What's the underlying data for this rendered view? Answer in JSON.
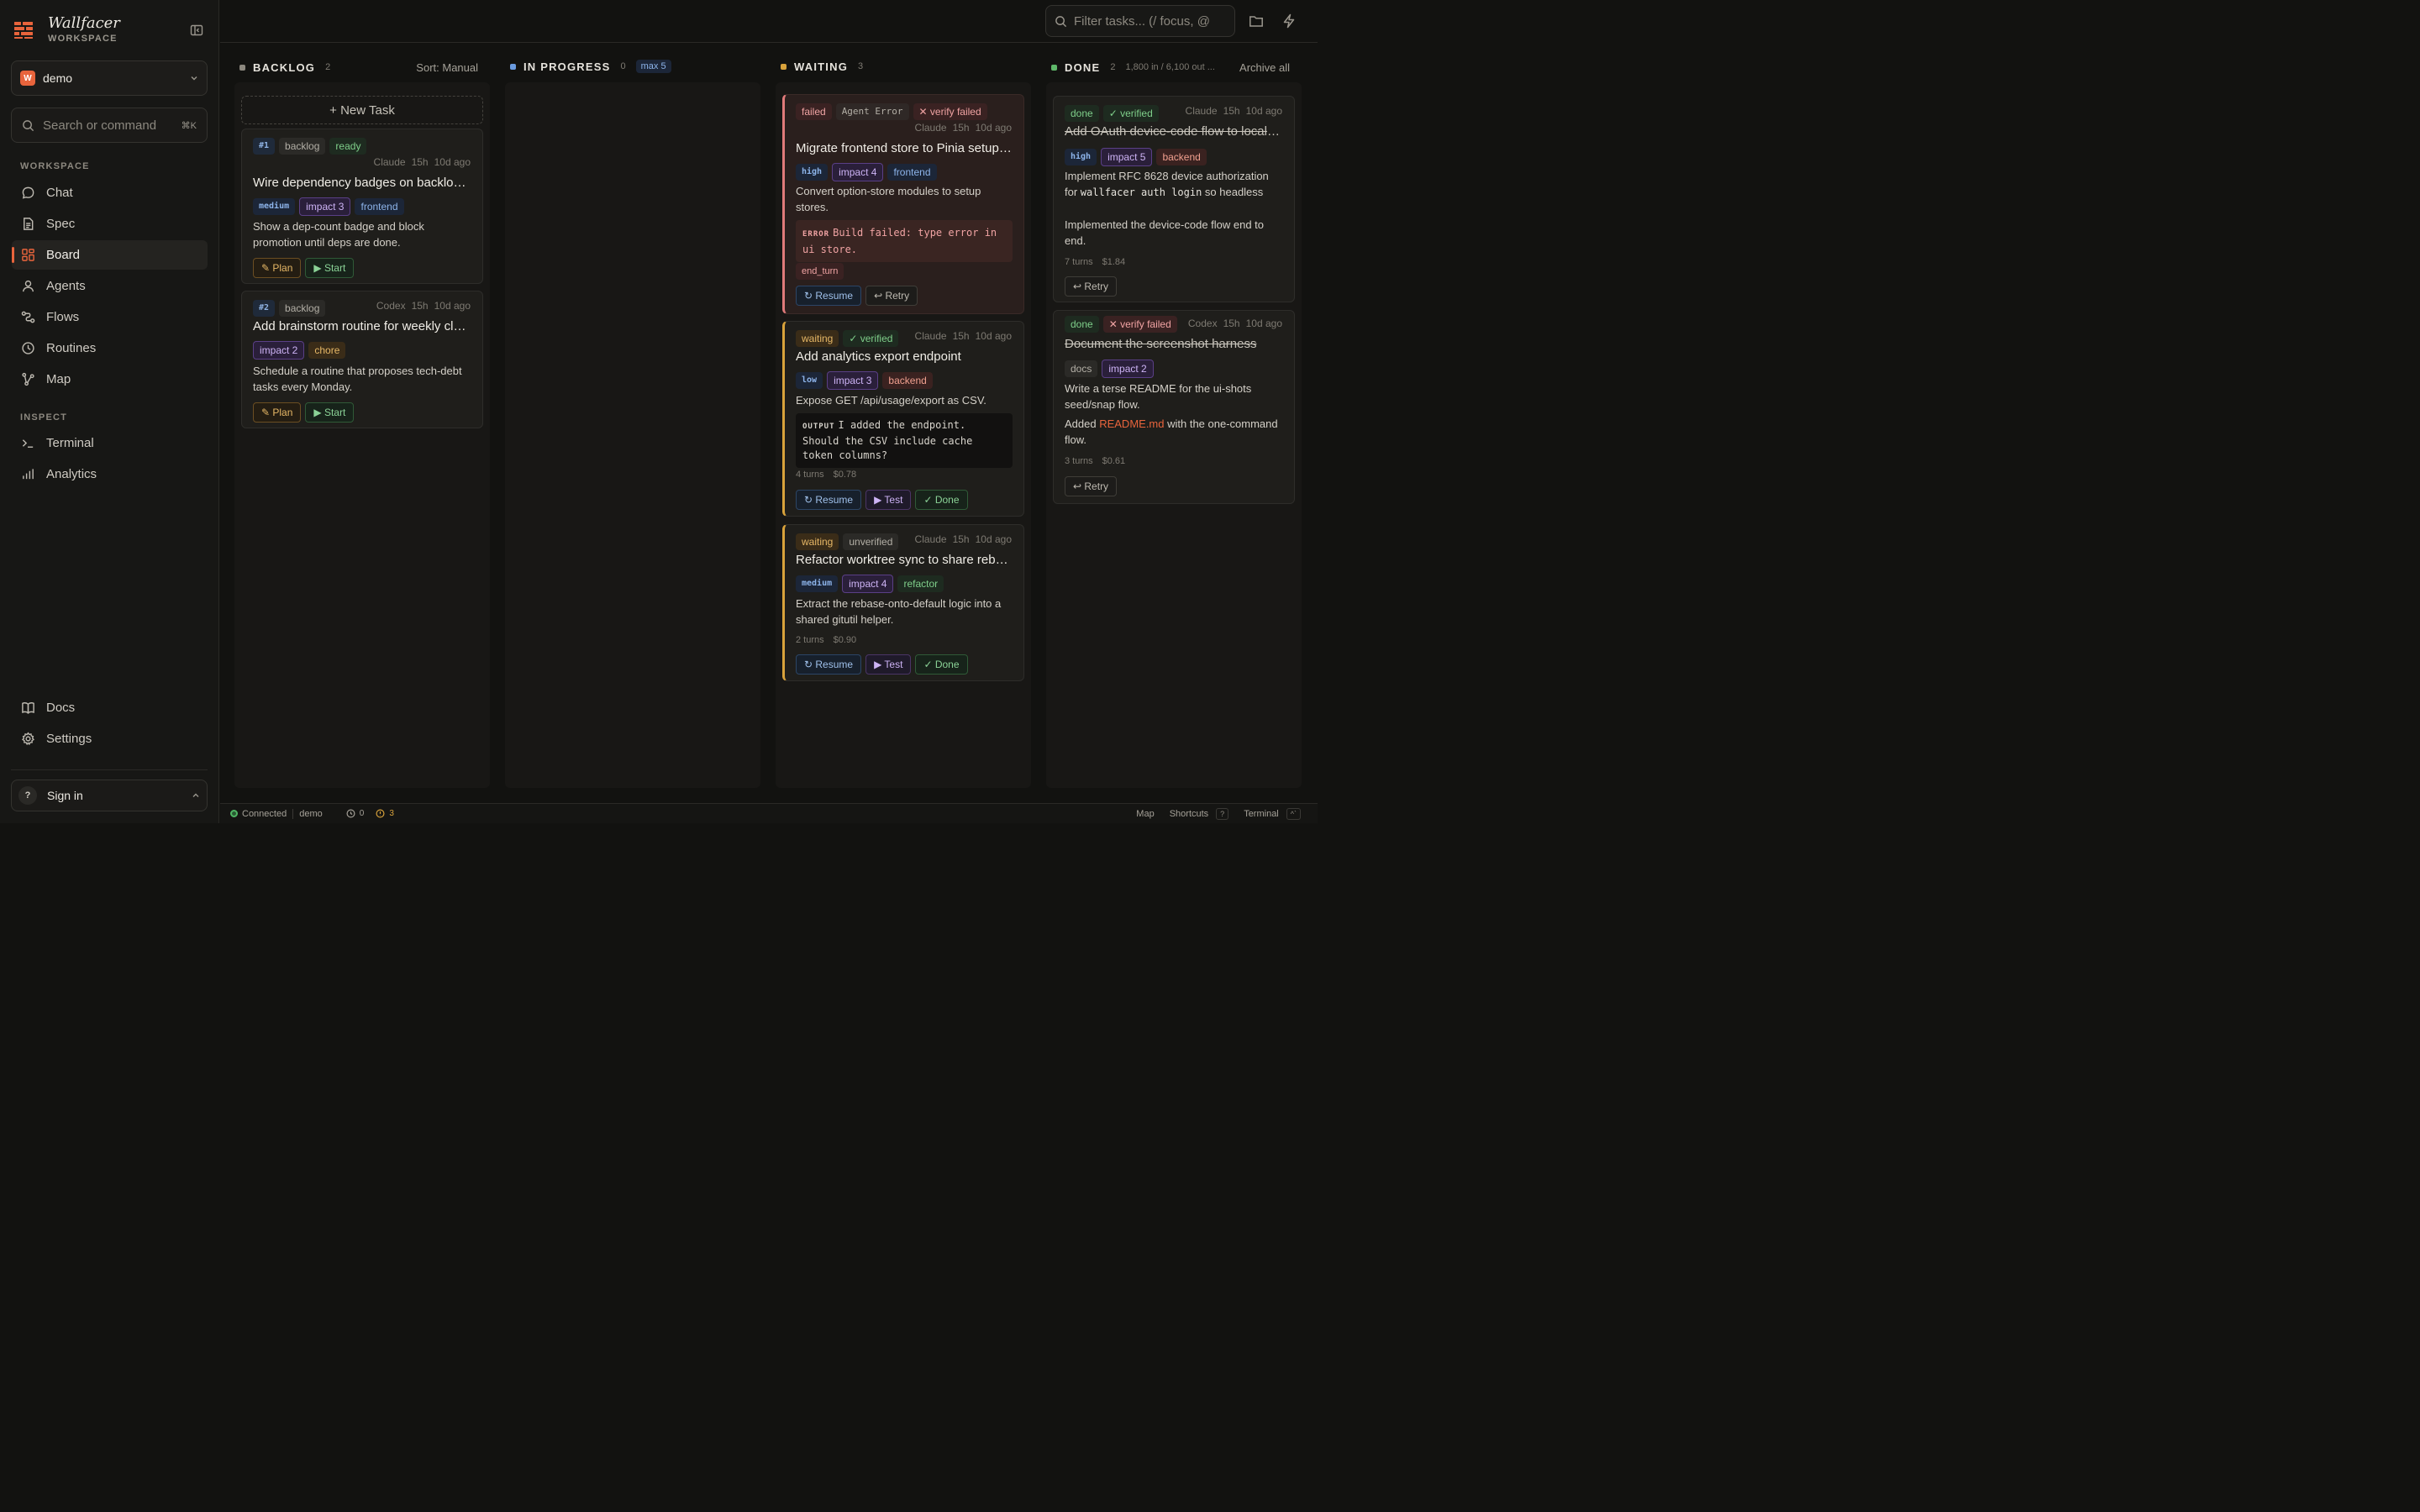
{
  "brand": {
    "title": "Wallfacer",
    "subtitle": "WORKSPACE",
    "logo_icon": "brick-wall-icon"
  },
  "workspace": {
    "badge": "W",
    "name": "demo"
  },
  "search": {
    "placeholder": "Search or command",
    "shortcut": "⌘K"
  },
  "nav": {
    "workspace_label": "WORKSPACE",
    "inspect_label": "INSPECT",
    "items": [
      {
        "label": "Chat",
        "icon": "chat-bubble-icon"
      },
      {
        "label": "Spec",
        "icon": "document-icon"
      },
      {
        "label": "Board",
        "icon": "grid-icon",
        "active": true
      },
      {
        "label": "Agents",
        "icon": "person-icon"
      },
      {
        "label": "Flows",
        "icon": "flow-icon"
      },
      {
        "label": "Routines",
        "icon": "clock-icon"
      },
      {
        "label": "Map",
        "icon": "branch-icon"
      },
      {
        "label": "Terminal",
        "icon": "terminal-icon"
      },
      {
        "label": "Analytics",
        "icon": "bar-chart-icon"
      },
      {
        "label": "Docs",
        "icon": "book-icon"
      },
      {
        "label": "Settings",
        "icon": "gear-icon"
      }
    ]
  },
  "signin": {
    "avatar": "?",
    "label": "Sign in"
  },
  "topbar": {
    "filter_placeholder": "Filter tasks... (/ focus, @"
  },
  "columns": {
    "backlog": {
      "title": "BACKLOG",
      "count": "2",
      "right": "Sort: Manual",
      "color": "#8c887f"
    },
    "in_progress": {
      "title": "IN PROGRESS",
      "count": "0",
      "badge": "max 5",
      "color": "#6a9be0"
    },
    "waiting": {
      "title": "WAITING",
      "count": "3",
      "color": "#d8a23b"
    },
    "done": {
      "title": "DONE",
      "count": "2",
      "usage": "1,800 in / 6,100 out ...",
      "right": "Archive all",
      "color": "#5fb86a"
    }
  },
  "new_task_label": "+ New Task",
  "backlog_cards": [
    {
      "id": "#1",
      "status": "backlog",
      "state": "ready",
      "agent": "Claude",
      "time": "15h",
      "age": "10d ago",
      "title": "Wire dependency badges on backlog cards",
      "priority": "medium",
      "impact": "impact 3",
      "area": "frontend",
      "desc": "Show a dep-count badge and block promotion until deps are done.",
      "btn_plan": "✎ Plan",
      "btn_start": "▶ Start"
    },
    {
      "id": "#2",
      "status": "backlog",
      "agent": "Codex",
      "time": "15h",
      "age": "10d ago",
      "title": "Add brainstorm routine for weekly cleanup",
      "impact": "impact 2",
      "area": "chore",
      "desc": "Schedule a routine that proposes tech-debt tasks every Monday.",
      "btn_plan": "✎ Plan",
      "btn_start": "▶ Start"
    }
  ],
  "waiting_cards": [
    {
      "status": "failed",
      "error_tag": "Agent Error",
      "verify": "✕ verify failed",
      "agent": "Claude",
      "time": "15h",
      "age": "10d ago",
      "title": "Migrate frontend store to Pinia setup stores",
      "priority": "high",
      "impact": "impact 4",
      "area": "frontend",
      "desc": "Convert option-store modules to setup stores.",
      "error_label": "ERROR",
      "error_text": "Build failed: type error in ui store.",
      "stop_reason": "end_turn",
      "btn_resume": "↻ Resume",
      "btn_retry": "↩ Retry"
    },
    {
      "status": "waiting",
      "verify": "✓ verified",
      "agent": "Claude",
      "time": "15h",
      "age": "10d ago",
      "title": "Add analytics export endpoint",
      "priority": "low",
      "impact": "impact 3",
      "area": "backend",
      "desc": "Expose GET /api/usage/export as CSV.",
      "output_label": "OUTPUT",
      "output_text": "I added the endpoint. Should the CSV include cache token columns?",
      "turns": "4 turns",
      "cost": "$0.78",
      "btn_resume": "↻ Resume",
      "btn_test": "▶ Test",
      "btn_done": "✓ Done"
    },
    {
      "status": "waiting",
      "verify": "unverified",
      "agent": "Claude",
      "time": "15h",
      "age": "10d ago",
      "title": "Refactor worktree sync to share rebase logic",
      "priority": "medium",
      "impact": "impact 4",
      "area": "refactor",
      "desc": "Extract the rebase-onto-default logic into a shared gitutil helper.",
      "turns": "2 turns",
      "cost": "$0.90",
      "btn_resume": "↻ Resume",
      "btn_test": "▶ Test",
      "btn_done": "✓ Done"
    }
  ],
  "done_cards": [
    {
      "status": "done",
      "verify": "✓ verified",
      "agent": "Claude",
      "time": "15h",
      "age": "10d ago",
      "title": "Add OAuth device-code flow to local installs",
      "priority": "high",
      "impact": "impact 5",
      "area": "backend",
      "desc_pre": "Implement RFC 8628 device authorization for ",
      "desc_code": "wallfacer auth login",
      "desc_post": " so headless and remote installs can authenticate without a",
      "result": "Implemented the device-code flow end to end.",
      "turns": "7 turns",
      "cost": "$1.84",
      "btn_retry": "↩ Retry"
    },
    {
      "status": "done",
      "verify": "✕ verify failed",
      "agent": "Codex",
      "time": "15h",
      "age": "10d ago",
      "title": "Document the screenshot harness",
      "area": "docs",
      "impact": "impact 2",
      "desc": "Write a terse README for the ui-shots seed/snap flow.",
      "result_pre": "Added ",
      "result_link": "README.md",
      "result_post": " with the one-command flow.",
      "turns": "3 turns",
      "cost": "$0.61",
      "btn_retry": "↩ Retry"
    }
  ],
  "statusbar": {
    "connected": "Connected",
    "workspace": "demo",
    "timers": "0",
    "alerts": "3",
    "map": "Map",
    "shortcuts": "Shortcuts",
    "shortcuts_key": "?",
    "terminal": "Terminal",
    "terminal_key": "^`"
  }
}
